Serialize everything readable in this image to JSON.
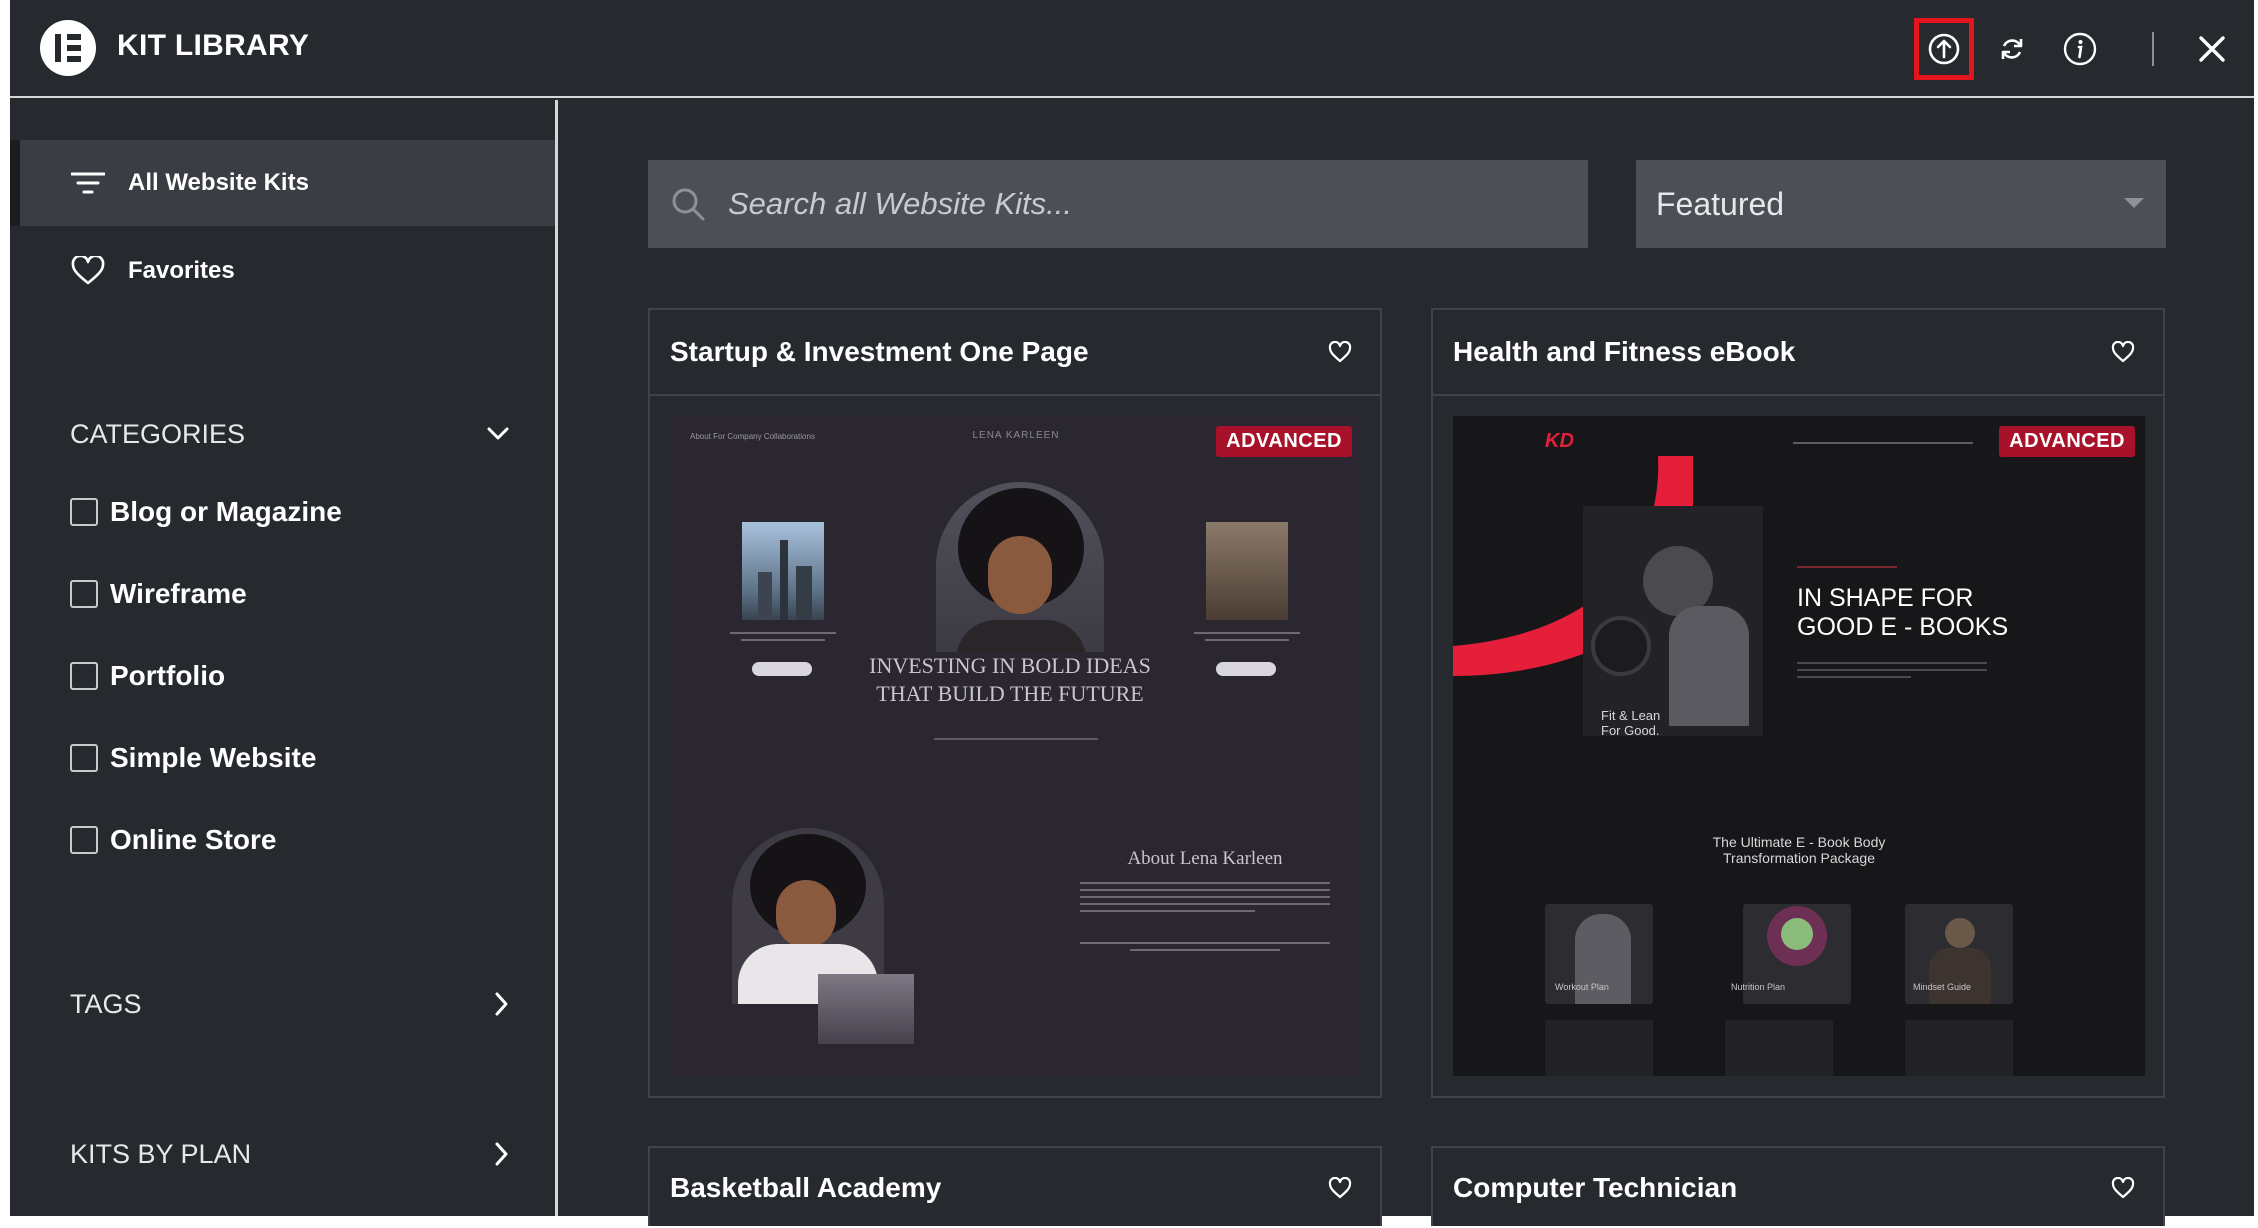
{
  "header": {
    "title": "KIT LIBRARY",
    "icons": [
      "upload-icon",
      "sync-icon",
      "info-icon",
      "close-icon"
    ]
  },
  "sidebar": {
    "all_kits": "All Website Kits",
    "favorites": "Favorites",
    "categories_label": "CATEGORIES",
    "categories": [
      "Blog or Magazine",
      "Wireframe",
      "Portfolio",
      "Simple Website",
      "Online Store"
    ],
    "tags_label": "TAGS",
    "plans_label": "KITS BY PLAN"
  },
  "search": {
    "placeholder": "Search all Website Kits..."
  },
  "sort": {
    "value": "Featured"
  },
  "cards": [
    {
      "title": "Startup & Investment One Page",
      "badge": "ADVANCED",
      "preview": {
        "brand": "LENA KARLEEN",
        "nav": "About   For Company   Collaborations",
        "hero": "INVESTING IN BOLD IDEAS THAT BUILD THE FUTURE",
        "about": "About Lena Karleen"
      }
    },
    {
      "title": "Health and Fitness eBook",
      "badge": "ADVANCED",
      "preview": {
        "logo": "KD",
        "hero": "IN SHAPE FOR GOOD E - BOOKS",
        "book": "Fit & Lean For Good.",
        "package": "The Ultimate E - Book Body Transformation Package",
        "thumbs": [
          "Workout Plan",
          "Nutrition Plan",
          "Mindset Guide"
        ]
      }
    },
    {
      "title": "Basketball Academy"
    },
    {
      "title": "Computer Technician"
    }
  ],
  "colors": {
    "badge": "#a8112a",
    "highlight": "#e3141e",
    "accent": "#e51f3a"
  }
}
